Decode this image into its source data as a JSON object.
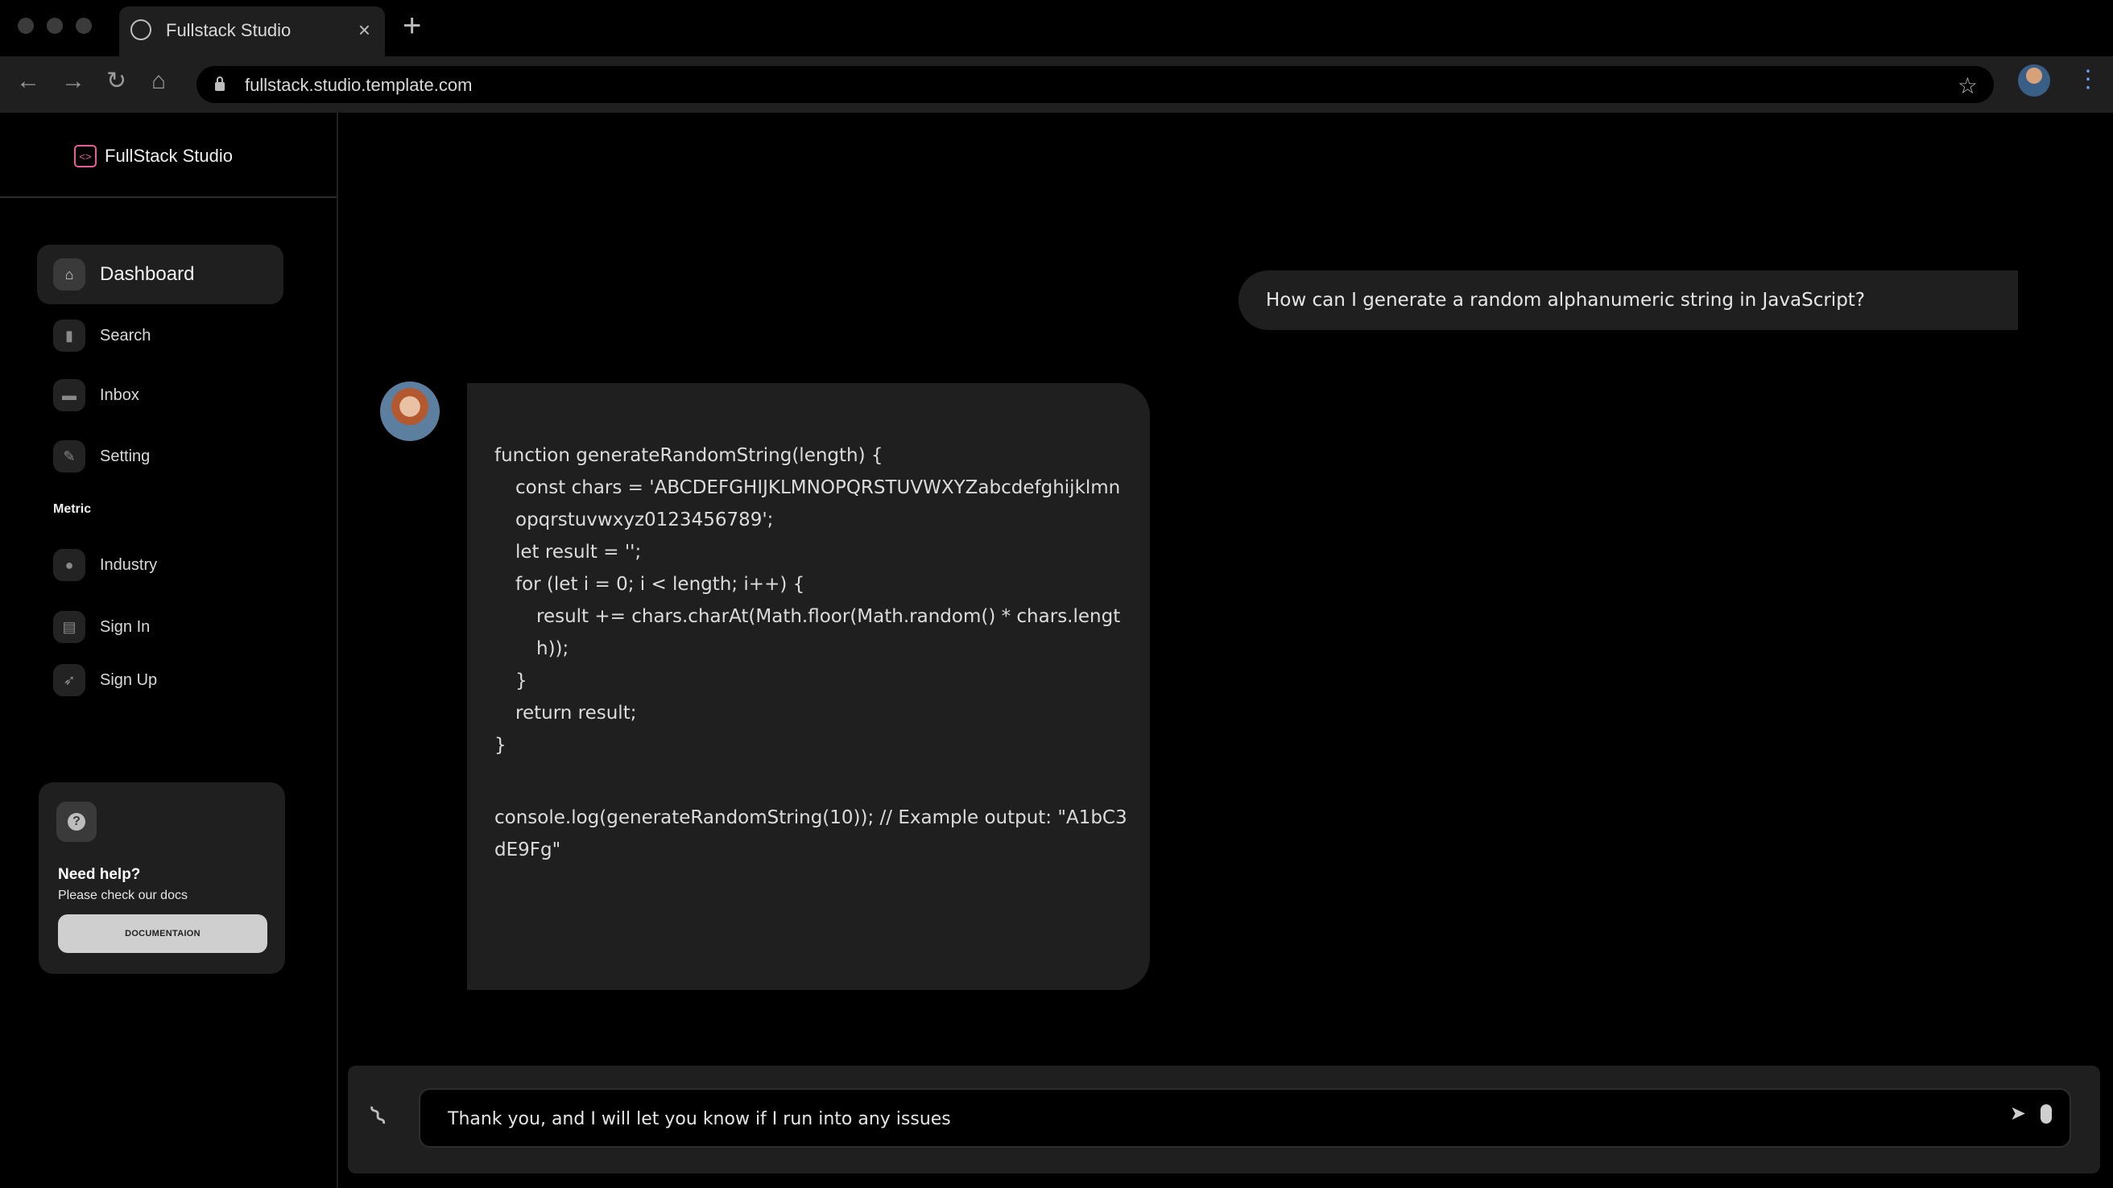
{
  "browser": {
    "tab_title": "Fullstack Studio",
    "url": "fullstack.studio.template.com"
  },
  "sidebar": {
    "brand": "FullStack Studio",
    "items": [
      {
        "label": "Dashboard",
        "icon": "home-icon",
        "active": true
      },
      {
        "label": "Search",
        "icon": "bar-chart-icon"
      },
      {
        "label": "Inbox",
        "icon": "credit-card-icon"
      },
      {
        "label": "Setting",
        "icon": "wrench-icon"
      }
    ],
    "section_label": "Metric",
    "metric_items": [
      {
        "label": "Industry",
        "icon": "person-icon"
      },
      {
        "label": "Sign In",
        "icon": "document-icon"
      },
      {
        "label": "Sign Up",
        "icon": "rocket-icon"
      }
    ],
    "help": {
      "title": "Need help?",
      "subtitle": "Please check our docs",
      "button_label": "DOCUMENTAION"
    }
  },
  "chat": {
    "user_message": "How can I generate a random alphanumeric string in JavaScript?",
    "bot_code": [
      "function generateRandomString(length) {",
      "const chars = 'ABCDEFGHIJKLMNOPQRSTUVWXYZabcdefghijklmnopqrstuvwxyz0123456789';",
      "let result = '';",
      "for (let i = 0; i < length; i++) {",
      "result += chars.charAt(Math.floor(Math.random() * chars.length));",
      "}",
      "return result;",
      "}",
      "console.log(generateRandomString(10)); // Example output: \"A1bC3dE9Fg\""
    ]
  },
  "composer": {
    "value": "Thank you, and I will let you know if I run into any issues"
  },
  "colors": {
    "brand_accent": "#e85d9a",
    "panel": "#1f1f1f",
    "background": "#000000"
  }
}
